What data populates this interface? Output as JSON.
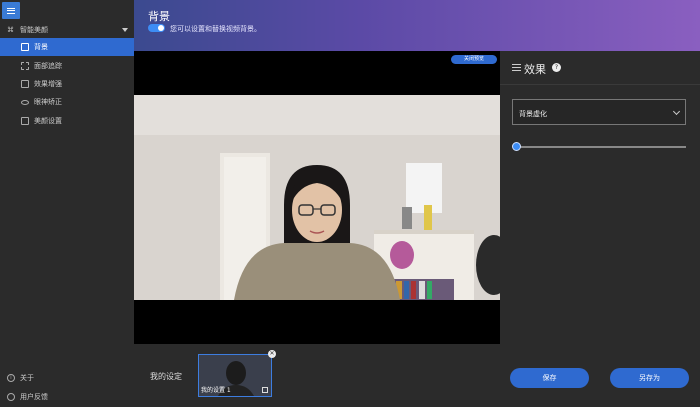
{
  "sidebar": {
    "section_label": "智能美颜",
    "items": [
      {
        "label": "背景",
        "active": true
      },
      {
        "label": "面部追踪"
      },
      {
        "label": "效果增强"
      },
      {
        "label": "眼神矫正"
      },
      {
        "label": "美颜设置"
      }
    ],
    "footer": [
      {
        "label": "关于"
      },
      {
        "label": "用户反馈"
      }
    ]
  },
  "banner": {
    "title": "背景",
    "description": "您可以设置和替换视频背景。",
    "toggle_on": true
  },
  "preview": {
    "close_label": "关闭预览"
  },
  "presets": {
    "label": "我的设定",
    "items": [
      {
        "name": "我的设置 1"
      }
    ]
  },
  "panel": {
    "title": "效果",
    "select_value": "背景虚化",
    "slider_value": 0
  },
  "buttons": {
    "save": "保存",
    "save_as": "另存为"
  },
  "colors": {
    "accent": "#2f6ad0",
    "banner_start": "#3b4a8f",
    "banner_end": "#8a5fc0"
  }
}
